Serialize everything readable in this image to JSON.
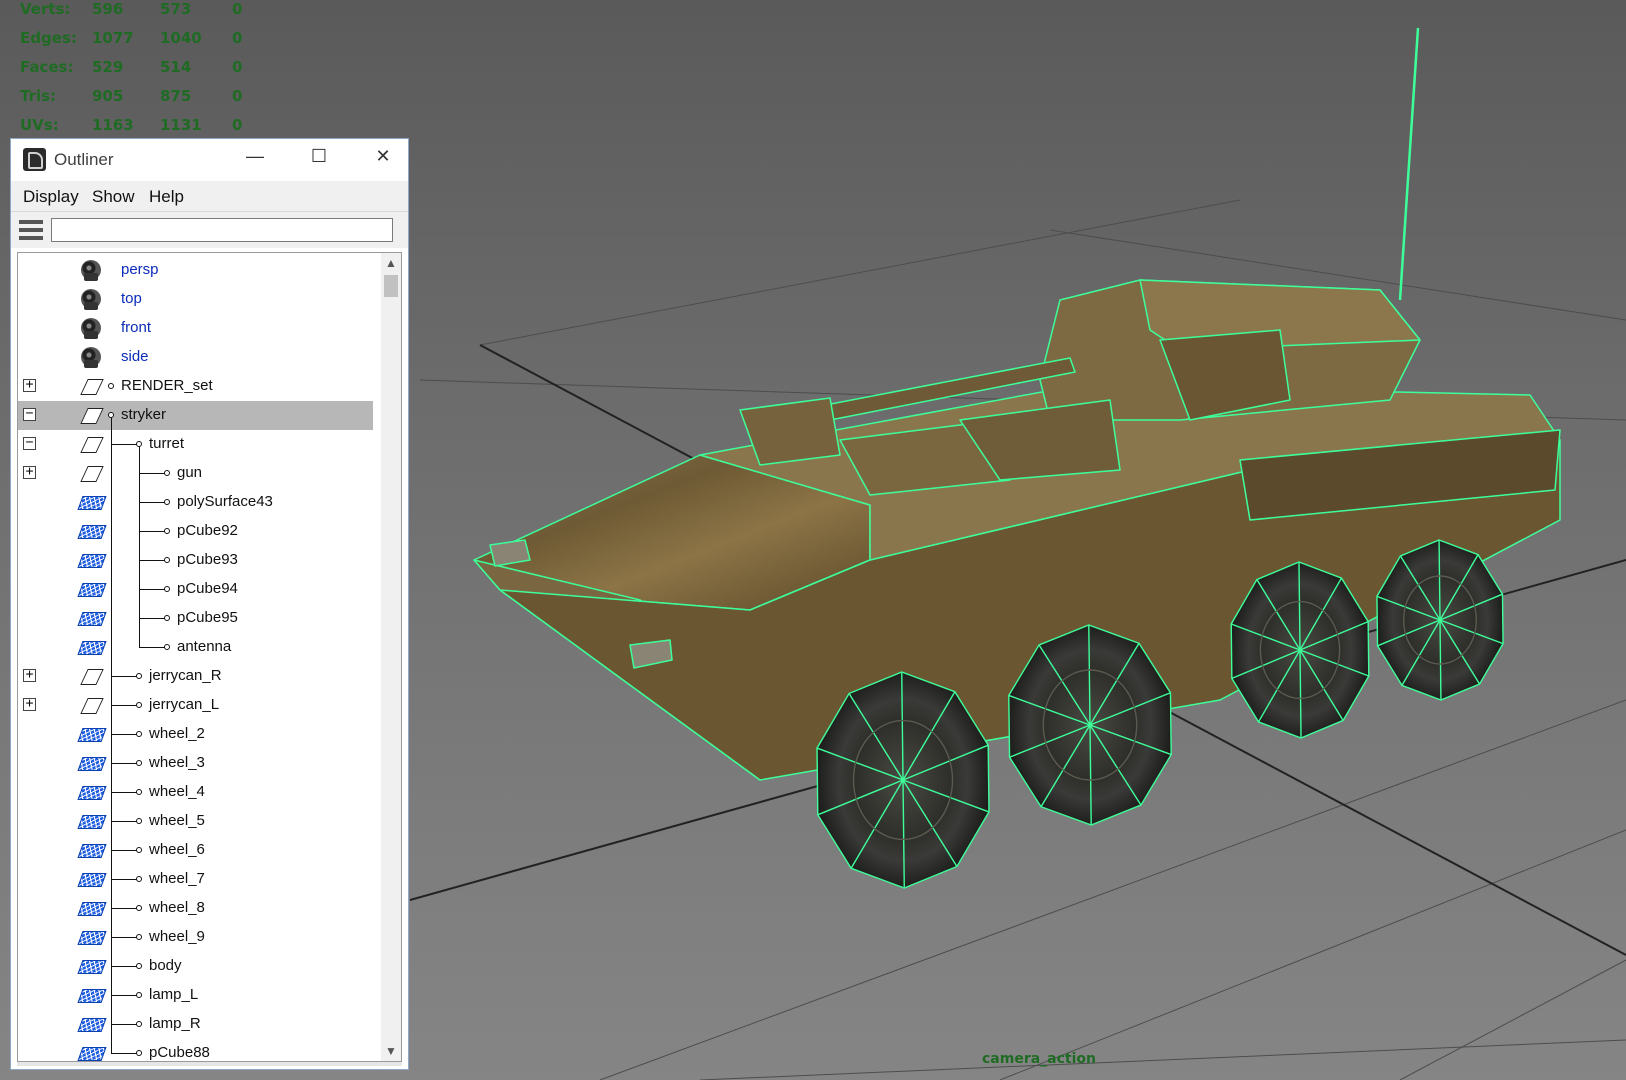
{
  "hud": {
    "rows": [
      {
        "label": "Verts:",
        "v1": "596",
        "v2": "573",
        "v3": "0"
      },
      {
        "label": "Edges:",
        "v1": "1077",
        "v2": "1040",
        "v3": "0"
      },
      {
        "label": "Faces:",
        "v1": "529",
        "v2": "514",
        "v3": "0"
      },
      {
        "label": "Tris:",
        "v1": "905",
        "v2": "875",
        "v3": "0"
      },
      {
        "label": "UVs:",
        "v1": "1163",
        "v2": "1131",
        "v3": "0"
      }
    ],
    "color": "#1f6b24"
  },
  "viewport": {
    "camera_label": "camera_action",
    "wireframe_color": "#3dff9a"
  },
  "outliner": {
    "title": "Outliner",
    "window_buttons": {
      "minimize": "—",
      "maximize": "☐",
      "close": "✕"
    },
    "menu": [
      "Display",
      "Show",
      "Help"
    ],
    "search": {
      "value": "",
      "placeholder": ""
    },
    "rows": [
      {
        "label": "persp",
        "icon": "camera-icon",
        "depth": 0,
        "expander": "",
        "selected": false,
        "camera": true
      },
      {
        "label": "top",
        "icon": "camera-icon",
        "depth": 0,
        "expander": "",
        "selected": false,
        "camera": true
      },
      {
        "label": "front",
        "icon": "camera-icon",
        "depth": 0,
        "expander": "",
        "selected": false,
        "camera": true
      },
      {
        "label": "side",
        "icon": "camera-icon",
        "depth": 0,
        "expander": "",
        "selected": false,
        "camera": true
      },
      {
        "label": "RENDER_set",
        "icon": "transform-icon",
        "depth": 0,
        "expander": "+",
        "selected": false,
        "camera": false
      },
      {
        "label": "stryker",
        "icon": "transform-icon",
        "depth": 0,
        "expander": "−",
        "selected": true,
        "camera": false
      },
      {
        "label": "turret",
        "icon": "transform-icon",
        "depth": 1,
        "expander": "−",
        "selected": false,
        "camera": false
      },
      {
        "label": "gun",
        "icon": "transform-icon",
        "depth": 2,
        "expander": "+",
        "selected": false,
        "camera": false
      },
      {
        "label": "polySurface43",
        "icon": "mesh-icon",
        "depth": 2,
        "expander": "",
        "selected": false,
        "camera": false
      },
      {
        "label": "pCube92",
        "icon": "mesh-icon",
        "depth": 2,
        "expander": "",
        "selected": false,
        "camera": false
      },
      {
        "label": "pCube93",
        "icon": "mesh-icon",
        "depth": 2,
        "expander": "",
        "selected": false,
        "camera": false
      },
      {
        "label": "pCube94",
        "icon": "mesh-icon",
        "depth": 2,
        "expander": "",
        "selected": false,
        "camera": false
      },
      {
        "label": "pCube95",
        "icon": "mesh-icon",
        "depth": 2,
        "expander": "",
        "selected": false,
        "camera": false
      },
      {
        "label": "antenna",
        "icon": "mesh-icon",
        "depth": 2,
        "expander": "",
        "selected": false,
        "camera": false
      },
      {
        "label": "jerrycan_R",
        "icon": "transform-icon",
        "depth": 1,
        "expander": "+",
        "selected": false,
        "camera": false
      },
      {
        "label": "jerrycan_L",
        "icon": "transform-icon",
        "depth": 1,
        "expander": "+",
        "selected": false,
        "camera": false
      },
      {
        "label": "wheel_2",
        "icon": "mesh-icon",
        "depth": 1,
        "expander": "",
        "selected": false,
        "camera": false
      },
      {
        "label": "wheel_3",
        "icon": "mesh-icon",
        "depth": 1,
        "expander": "",
        "selected": false,
        "camera": false
      },
      {
        "label": "wheel_4",
        "icon": "mesh-icon",
        "depth": 1,
        "expander": "",
        "selected": false,
        "camera": false
      },
      {
        "label": "wheel_5",
        "icon": "mesh-icon",
        "depth": 1,
        "expander": "",
        "selected": false,
        "camera": false
      },
      {
        "label": "wheel_6",
        "icon": "mesh-icon",
        "depth": 1,
        "expander": "",
        "selected": false,
        "camera": false
      },
      {
        "label": "wheel_7",
        "icon": "mesh-icon",
        "depth": 1,
        "expander": "",
        "selected": false,
        "camera": false
      },
      {
        "label": "wheel_8",
        "icon": "mesh-icon",
        "depth": 1,
        "expander": "",
        "selected": false,
        "camera": false
      },
      {
        "label": "wheel_9",
        "icon": "mesh-icon",
        "depth": 1,
        "expander": "",
        "selected": false,
        "camera": false
      },
      {
        "label": "body",
        "icon": "mesh-icon",
        "depth": 1,
        "expander": "",
        "selected": false,
        "camera": false
      },
      {
        "label": "lamp_L",
        "icon": "mesh-icon",
        "depth": 1,
        "expander": "",
        "selected": false,
        "camera": false
      },
      {
        "label": "lamp_R",
        "icon": "mesh-icon",
        "depth": 1,
        "expander": "",
        "selected": false,
        "camera": false
      },
      {
        "label": "pCube88",
        "icon": "mesh-icon",
        "depth": 1,
        "expander": "",
        "selected": false,
        "camera": false
      }
    ]
  }
}
